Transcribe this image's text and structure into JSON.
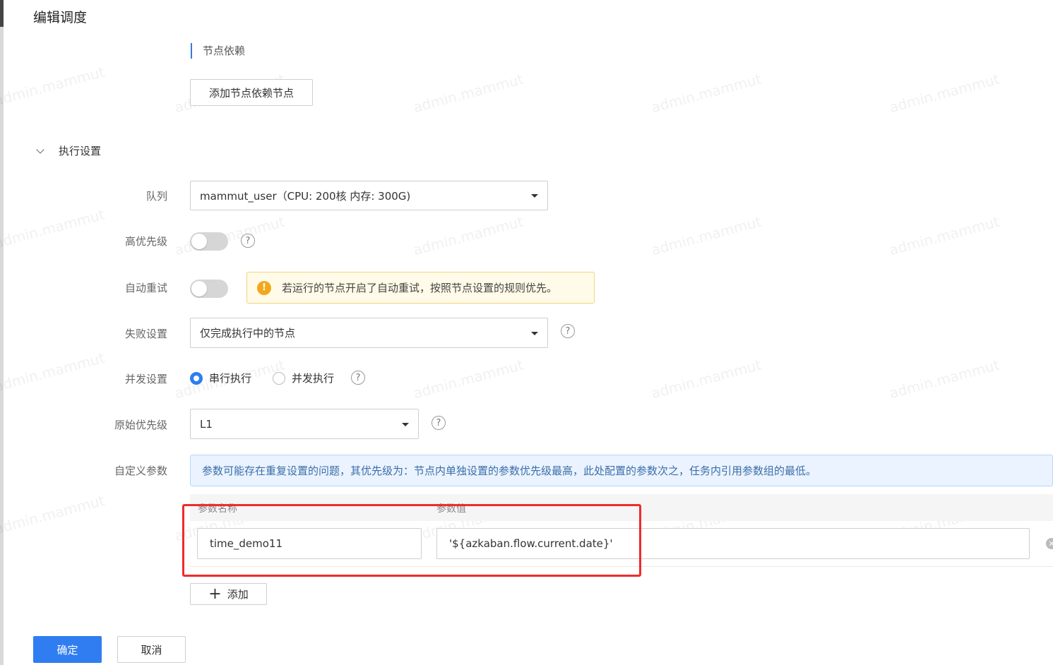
{
  "dialog": {
    "title": "编辑调度"
  },
  "dependency": {
    "label": "节点依赖",
    "add_button": "添加节点依赖节点"
  },
  "exec_section": {
    "label": "执行设置"
  },
  "queue": {
    "label": "队列",
    "value": "mammut_user（CPU: 200核 内存: 300G)"
  },
  "high_priority": {
    "label": "高优先级",
    "on": false,
    "help": "?"
  },
  "auto_retry": {
    "label": "自动重试",
    "on": false,
    "warning_icon": "!",
    "warning": "若运行的节点开启了自动重试，按照节点设置的规则优先。"
  },
  "failure": {
    "label": "失败设置",
    "value": "仅完成执行中的节点",
    "help": "?"
  },
  "concurrency": {
    "label": "并发设置",
    "options": [
      "串行执行",
      "并发执行"
    ],
    "selected": 0,
    "help": "?"
  },
  "orig_priority": {
    "label": "原始优先级",
    "value": "L1",
    "help": "?"
  },
  "custom_params": {
    "label": "自定义参数",
    "info": "参数可能存在重复设置的问题，其优先级为：节点内单独设置的参数优先级最高，此处配置的参数次之，任务内引用参数组的最低。",
    "columns": [
      "参数名称",
      "参数值"
    ],
    "rows": [
      {
        "name": "time_demo11",
        "value": "'${azkaban.flow.current.date}'"
      }
    ],
    "add_button": "添加"
  },
  "footer": {
    "confirm": "确定",
    "cancel": "取消"
  },
  "watermark": "admin.mammut",
  "colors": {
    "primary": "#2f7df0",
    "highlight": "#f02b2b",
    "warning_bg": "#fffbe8",
    "info_bg": "#eaf3ff"
  }
}
